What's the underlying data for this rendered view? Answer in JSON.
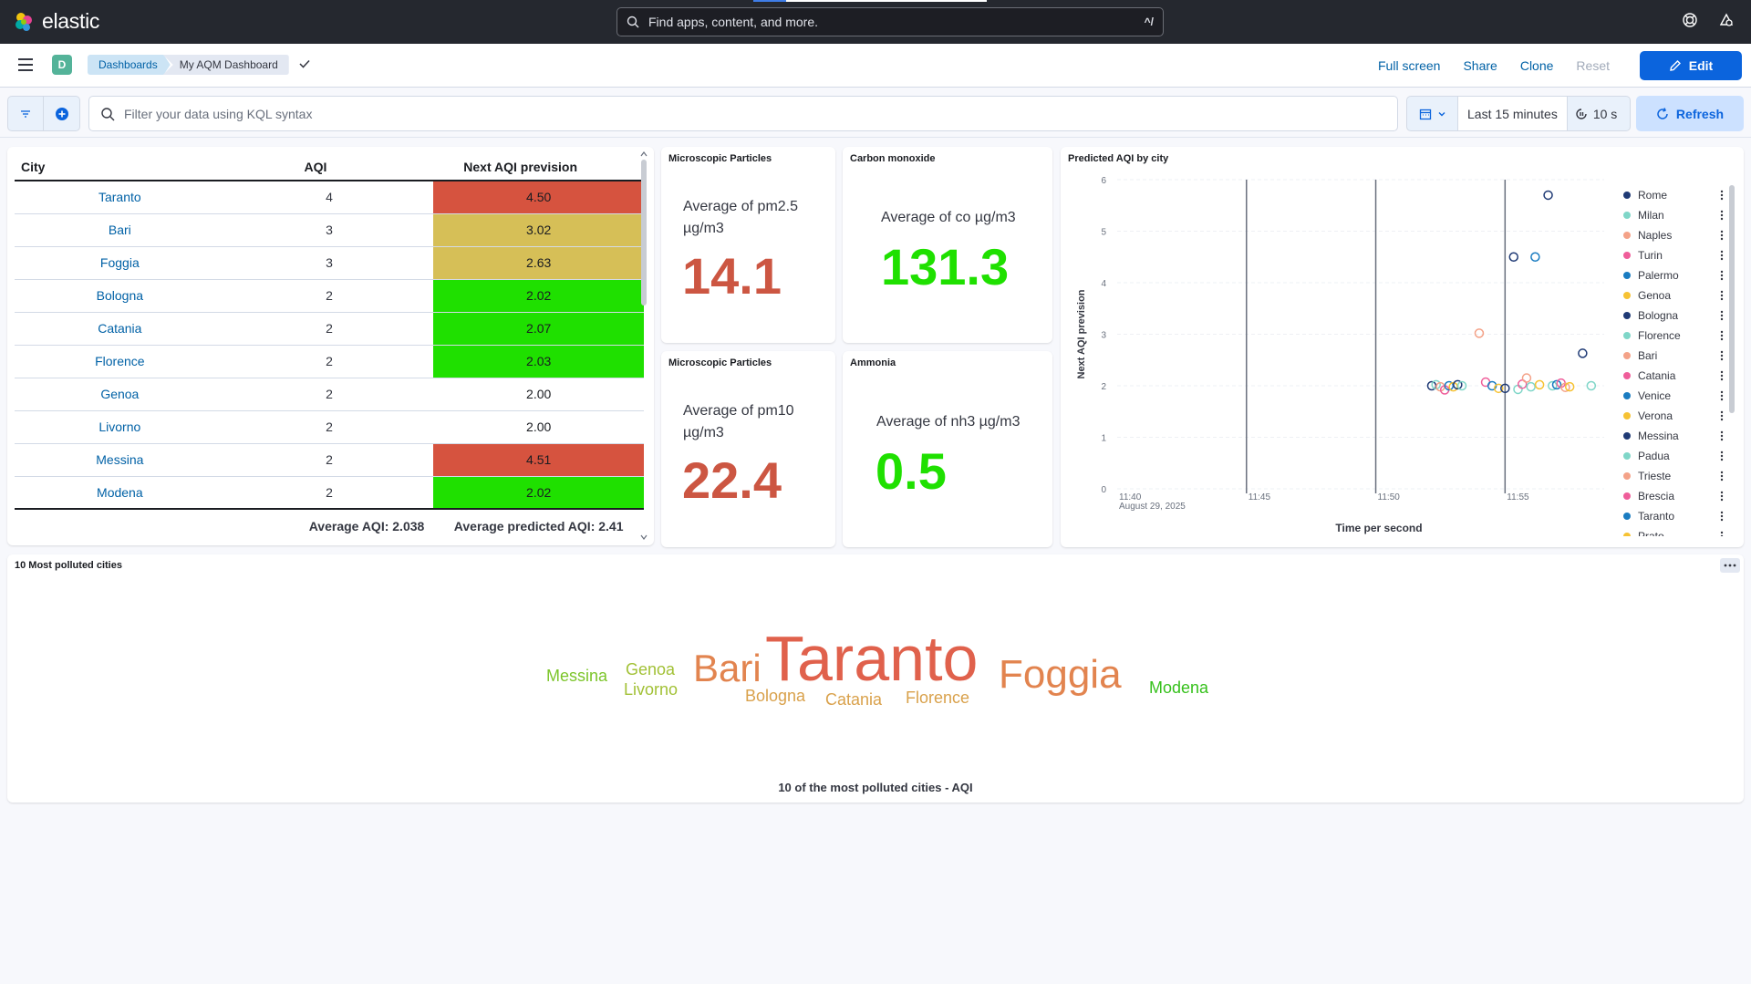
{
  "app": {
    "logo_text": "elastic",
    "search_placeholder": "Find apps, content, and more.",
    "search_shortcut": "^/"
  },
  "nav": {
    "space_initial": "D",
    "breadcrumbs": [
      "Dashboards",
      "My AQM Dashboard"
    ],
    "actions": {
      "full_screen": "Full screen",
      "share": "Share",
      "clone": "Clone",
      "reset": "Reset",
      "edit": "Edit"
    }
  },
  "query": {
    "kql_placeholder": "Filter your data using KQL syntax",
    "time_range": "Last 15 minutes",
    "refresh_interval": "10 s",
    "refresh_label": "Refresh"
  },
  "table_panel": {
    "columns": [
      "City",
      "AQI",
      "Next AQI prevision"
    ],
    "rows": [
      {
        "city": "Taranto",
        "aqi": "4",
        "next": "4.50",
        "color": "#d6533f"
      },
      {
        "city": "Bari",
        "aqi": "3",
        "next": "3.02",
        "color": "#d6bf57"
      },
      {
        "city": "Foggia",
        "aqi": "3",
        "next": "2.63",
        "color": "#d6bf57"
      },
      {
        "city": "Bologna",
        "aqi": "2",
        "next": "2.02",
        "color": "#1fe000"
      },
      {
        "city": "Catania",
        "aqi": "2",
        "next": "2.07",
        "color": "#1fe000"
      },
      {
        "city": "Florence",
        "aqi": "2",
        "next": "2.03",
        "color": "#1fe000"
      },
      {
        "city": "Genoa",
        "aqi": "2",
        "next": "2.00",
        "color": ""
      },
      {
        "city": "Livorno",
        "aqi": "2",
        "next": "2.00",
        "color": ""
      },
      {
        "city": "Messina",
        "aqi": "2",
        "next": "4.51",
        "color": "#d6533f"
      },
      {
        "city": "Modena",
        "aqi": "2",
        "next": "2.02",
        "color": "#1fe000"
      }
    ],
    "footer": {
      "avg_aqi": "Average AQI: 2.038",
      "avg_predicted": "Average predicted AQI: 2.41"
    }
  },
  "metrics": [
    {
      "title": "Microscopic Particles",
      "label": "Average of pm2.5 µg/m3",
      "value": "14.1",
      "color": "#cc5642"
    },
    {
      "title": "Carbon monoxide",
      "label": "Average of co µg/m3",
      "value": "131.3",
      "color": "#1fe000"
    },
    {
      "title": "Microscopic Particles",
      "label": "Average of pm10 µg/m3",
      "value": "22.4",
      "color": "#cc5642"
    },
    {
      "title": "Ammonia",
      "label": "Average of nh3 µg/m3",
      "value": "0.5",
      "color": "#1fe000"
    }
  ],
  "scatter_panel": {
    "title": "Predicted AQI by city",
    "legend": [
      {
        "name": "Rome",
        "color": "#1f3a75"
      },
      {
        "name": "Milan",
        "color": "#7fd6c8"
      },
      {
        "name": "Naples",
        "color": "#f4a288"
      },
      {
        "name": "Turin",
        "color": "#ef5d9a"
      },
      {
        "name": "Palermo",
        "color": "#1a7cc1"
      },
      {
        "name": "Genoa",
        "color": "#f6c233"
      },
      {
        "name": "Bologna",
        "color": "#1f3a75"
      },
      {
        "name": "Florence",
        "color": "#7fd6c8"
      },
      {
        "name": "Bari",
        "color": "#f4a288"
      },
      {
        "name": "Catania",
        "color": "#ef5d9a"
      },
      {
        "name": "Venice",
        "color": "#1a7cc1"
      },
      {
        "name": "Verona",
        "color": "#f6c233"
      },
      {
        "name": "Messina",
        "color": "#1f3a75"
      },
      {
        "name": "Padua",
        "color": "#7fd6c8"
      },
      {
        "name": "Trieste",
        "color": "#f4a288"
      },
      {
        "name": "Brescia",
        "color": "#ef5d9a"
      },
      {
        "name": "Taranto",
        "color": "#1a7cc1"
      },
      {
        "name": "Prato",
        "color": "#f6c233"
      }
    ]
  },
  "chart_data": {
    "type": "scatter",
    "title": "Predicted AQI by city",
    "xlabel": "Time per second",
    "ylabel": "Next AQI prevision",
    "ylim": [
      0,
      6
    ],
    "y_ticks": [
      "0",
      "1",
      "2",
      "3",
      "4",
      "5",
      "6"
    ],
    "x_ticks": [
      "11:40",
      "11:45",
      "11:50",
      "11:55"
    ],
    "x_date_label": "August 29, 2025",
    "grid": true,
    "legend_position": "right",
    "points": [
      {
        "t": "11:52:10",
        "y": 2.0,
        "color": "#1f3a75"
      },
      {
        "t": "11:52:20",
        "y": 2.02,
        "color": "#7fd6c8"
      },
      {
        "t": "11:52:30",
        "y": 1.98,
        "color": "#f4a288"
      },
      {
        "t": "11:52:40",
        "y": 1.92,
        "color": "#ef5d9a"
      },
      {
        "t": "11:52:50",
        "y": 2.0,
        "color": "#1a7cc1"
      },
      {
        "t": "11:53:00",
        "y": 1.98,
        "color": "#f6c233"
      },
      {
        "t": "11:53:10",
        "y": 2.02,
        "color": "#1f3a75"
      },
      {
        "t": "11:53:20",
        "y": 2.0,
        "color": "#7fd6c8"
      },
      {
        "t": "11:54:00",
        "y": 3.02,
        "color": "#f4a288"
      },
      {
        "t": "11:54:15",
        "y": 2.07,
        "color": "#ef5d9a"
      },
      {
        "t": "11:54:30",
        "y": 2.0,
        "color": "#1a7cc1"
      },
      {
        "t": "11:54:45",
        "y": 1.95,
        "color": "#f6c233"
      },
      {
        "t": "11:55:00",
        "y": 1.95,
        "color": "#1f3a75"
      },
      {
        "t": "11:55:20",
        "y": 4.5,
        "color": "#1f3a75"
      },
      {
        "t": "11:55:30",
        "y": 1.93,
        "color": "#7fd6c8"
      },
      {
        "t": "11:55:40",
        "y": 2.03,
        "color": "#ef5d9a"
      },
      {
        "t": "11:55:50",
        "y": 2.15,
        "color": "#f4a288"
      },
      {
        "t": "11:56:00",
        "y": 1.98,
        "color": "#7fd6c8"
      },
      {
        "t": "11:56:10",
        "y": 4.5,
        "color": "#1a7cc1"
      },
      {
        "t": "11:56:20",
        "y": 2.02,
        "color": "#f6c233"
      },
      {
        "t": "11:56:40",
        "y": 5.7,
        "color": "#1f3a75"
      },
      {
        "t": "11:56:50",
        "y": 2.0,
        "color": "#7fd6c8"
      },
      {
        "t": "11:57:00",
        "y": 2.02,
        "color": "#1a7cc1"
      },
      {
        "t": "11:57:10",
        "y": 2.05,
        "color": "#ef5d9a"
      },
      {
        "t": "11:57:20",
        "y": 1.97,
        "color": "#f4a288"
      },
      {
        "t": "11:57:30",
        "y": 1.98,
        "color": "#f6c233"
      },
      {
        "t": "11:58:00",
        "y": 2.63,
        "color": "#1f3a75"
      },
      {
        "t": "11:58:20",
        "y": 2.0,
        "color": "#7fd6c8"
      }
    ]
  },
  "cloud_panel": {
    "title": "10 Most polluted cities",
    "caption": "10 of the most polluted cities - AQI",
    "words": [
      {
        "text": "Messina",
        "weight": 2,
        "color": "#7cc52a"
      },
      {
        "text": "Genoa",
        "weight": 2,
        "color": "#a2c136"
      },
      {
        "text": "Livorno",
        "weight": 2,
        "color": "#a2c136"
      },
      {
        "text": "Bari",
        "weight": 3,
        "color": "#e2844f"
      },
      {
        "text": "Taranto",
        "weight": 4,
        "color": "#e0614c"
      },
      {
        "text": "Bologna",
        "weight": 2,
        "color": "#d9a14b"
      },
      {
        "text": "Catania",
        "weight": 2,
        "color": "#d9a14b"
      },
      {
        "text": "Florence",
        "weight": 2,
        "color": "#d9a14b"
      },
      {
        "text": "Foggia",
        "weight": 3,
        "color": "#e2844f"
      },
      {
        "text": "Modena",
        "weight": 2,
        "color": "#36c11c"
      }
    ]
  }
}
